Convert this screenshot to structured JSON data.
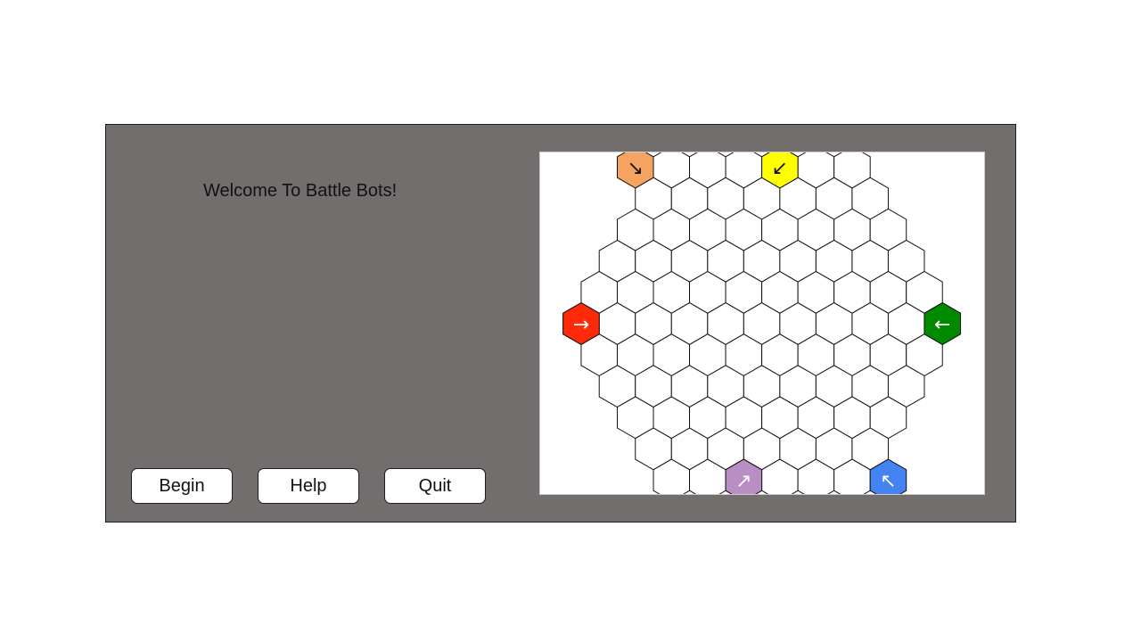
{
  "window": {
    "welcome_text": "Welcome To Battle Bots!"
  },
  "buttons": {
    "begin_label": "Begin",
    "help_label": "Help",
    "quit_label": "Quit"
  },
  "board": {
    "colors": {
      "orange": "#f4a460",
      "yellow": "#ffff00",
      "red": "#ff2a0a",
      "green": "#008a00",
      "purple": "#b98ec4",
      "blue": "#4582f2",
      "hex_fill": "#ffffff",
      "hex_stroke": "#111111"
    },
    "start_markers": [
      {
        "player": "orange",
        "arrow": "↘"
      },
      {
        "player": "yellow",
        "arrow": "↙"
      },
      {
        "player": "red",
        "arrow": "→"
      },
      {
        "player": "green",
        "arrow": "←"
      },
      {
        "player": "purple",
        "arrow": "↗"
      },
      {
        "player": "blue",
        "arrow": "↖"
      }
    ]
  }
}
